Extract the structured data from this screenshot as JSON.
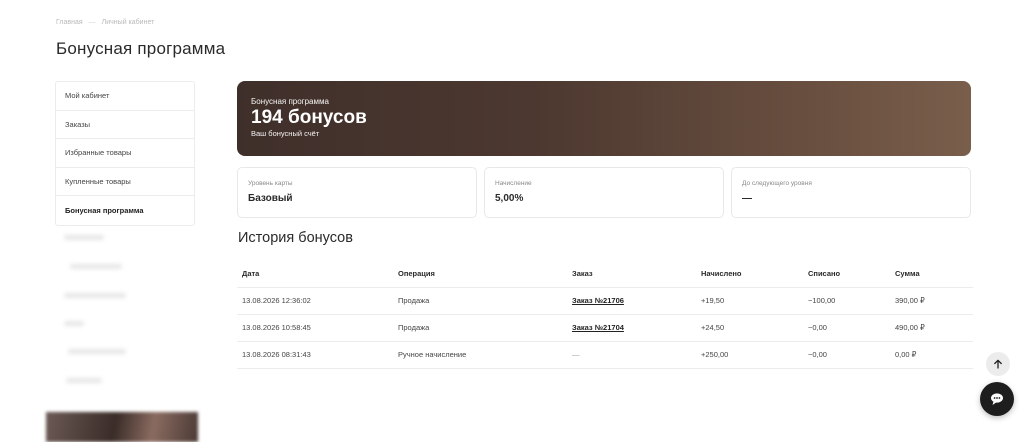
{
  "breadcrumb": {
    "home": "Главная",
    "separator": "—",
    "current": "Личный кабинет"
  },
  "page_title": "Бонусная программа",
  "sidebar": {
    "items": [
      {
        "label": "Мой кабинет",
        "active": false
      },
      {
        "label": "Заказы",
        "active": false
      },
      {
        "label": "Избранные товары",
        "active": false
      },
      {
        "label": "Купленные товары",
        "active": false
      },
      {
        "label": "Бонусная программа",
        "active": true
      }
    ]
  },
  "banner": {
    "label": "Бонусная программа",
    "value": "194 бонусов",
    "subtitle": "Ваш бонусный счёт"
  },
  "stats": [
    {
      "label": "Уровень карты",
      "value": "Базовый"
    },
    {
      "label": "Начисление",
      "value": "5,00%"
    },
    {
      "label": "До следующего уровня",
      "value": "—"
    }
  ],
  "history": {
    "title": "История бонусов",
    "columns": [
      "Дата",
      "Операция",
      "Заказ",
      "Начислено",
      "Списано",
      "Сумма"
    ],
    "rows": [
      {
        "date": "13.08.2026 12:36:02",
        "operation": "Продажа",
        "order": "Заказ №21706",
        "credited": "+19,50",
        "debited": "−100,00",
        "sum": "390,00 ₽"
      },
      {
        "date": "13.08.2026 10:58:45",
        "operation": "Продажа",
        "order": "Заказ №21704",
        "credited": "+24,50",
        "debited": "−0,00",
        "sum": "490,00 ₽"
      },
      {
        "date": "13.08.2026 08:31:43",
        "operation": "Ручное начисление",
        "order": "—",
        "credited": "+250,00",
        "debited": "−0,00",
        "sum": "0,00 ₽"
      }
    ]
  },
  "floating": {
    "scroll_top_icon": "arrow-up-icon",
    "chat_icon": "chat-icon"
  },
  "colors": {
    "banner_start": "#3f2f2a",
    "banner_end": "#7a5e4c",
    "chat_button": "#1e1e1e"
  }
}
